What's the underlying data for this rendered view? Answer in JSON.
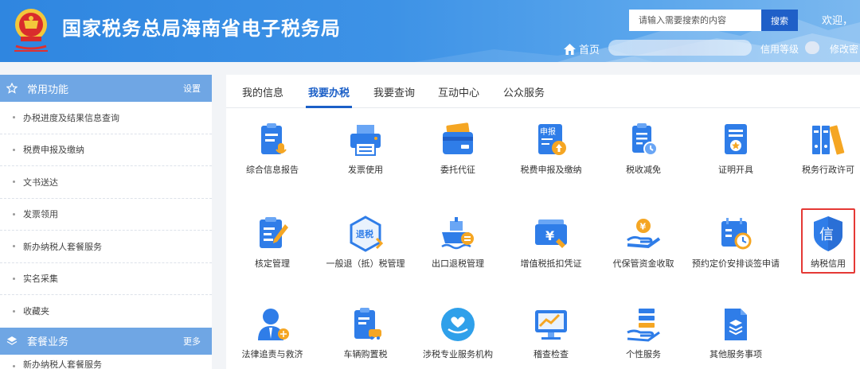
{
  "header": {
    "site_title": "国家税务总局海南省电子税务局",
    "search_placeholder": "请输入需要搜索的内容",
    "search_button": "搜索",
    "welcome": "欢迎，",
    "home_link": "首页",
    "credit_level": "信用等级",
    "modify_password": "修改密"
  },
  "sidebar": {
    "common": {
      "title": "常用功能",
      "action": "设置",
      "items": [
        "办税进度及结果信息查询",
        "税费申报及缴纳",
        "文书送达",
        "发票领用",
        "新办纳税人套餐服务",
        "实名采集",
        "收藏夹"
      ]
    },
    "package": {
      "title": "套餐业务",
      "action": "更多",
      "items": [
        "新办纳税人套餐服务"
      ]
    }
  },
  "tabs": [
    "我的信息",
    "我要办税",
    "我要查询",
    "互动中心",
    "公众服务"
  ],
  "active_tab": "我要办税",
  "services": [
    {
      "label": "综合信息报告",
      "icon": "clipboard-microphone-icon"
    },
    {
      "label": "发票使用",
      "icon": "printer-icon"
    },
    {
      "label": "委托代征",
      "icon": "wallet-card-icon"
    },
    {
      "label": "税费申报及缴纳",
      "icon": "declare-upload-icon",
      "badge": "申报"
    },
    {
      "label": "税收减免",
      "icon": "document-clock-icon"
    },
    {
      "label": "证明开具",
      "icon": "certificate-star-icon"
    },
    {
      "label": "税务行政许可",
      "icon": "binders-icon"
    },
    {
      "label": "核定管理",
      "icon": "clipboard-pen-icon"
    },
    {
      "label": "一般退（抵）税管理",
      "icon": "refund-hexagon-icon",
      "badge": "退税"
    },
    {
      "label": "出口退税管理",
      "icon": "cargo-ship-icon"
    },
    {
      "label": "增值税抵扣凭证",
      "icon": "yen-ticket-icon"
    },
    {
      "label": "代保管资金收取",
      "icon": "hand-coin-icon"
    },
    {
      "label": "预约定价安排谈签申请",
      "icon": "calendar-clock-icon"
    },
    {
      "label": "纳税信用",
      "icon": "credit-shield-icon",
      "badge": "信"
    },
    {
      "label": "法律追责与救济",
      "icon": "judge-scale-icon"
    },
    {
      "label": "车辆购置税",
      "icon": "clipboard-car-icon"
    },
    {
      "label": "涉税专业服务机构",
      "icon": "heart-hands-icon"
    },
    {
      "label": "稽查检查",
      "icon": "monitor-chart-icon"
    },
    {
      "label": "个性服务",
      "icon": "hand-list-icon"
    },
    {
      "label": "其他服务事项",
      "icon": "document-stack-icon"
    }
  ],
  "colors": {
    "header_blue": "#3a8fe4",
    "sidebar_header": "#6fa6e4",
    "active_tab": "#1b5fc7",
    "icon_blue": "#2f7de8",
    "icon_orange": "#f5a623",
    "highlight": "#e53935"
  }
}
